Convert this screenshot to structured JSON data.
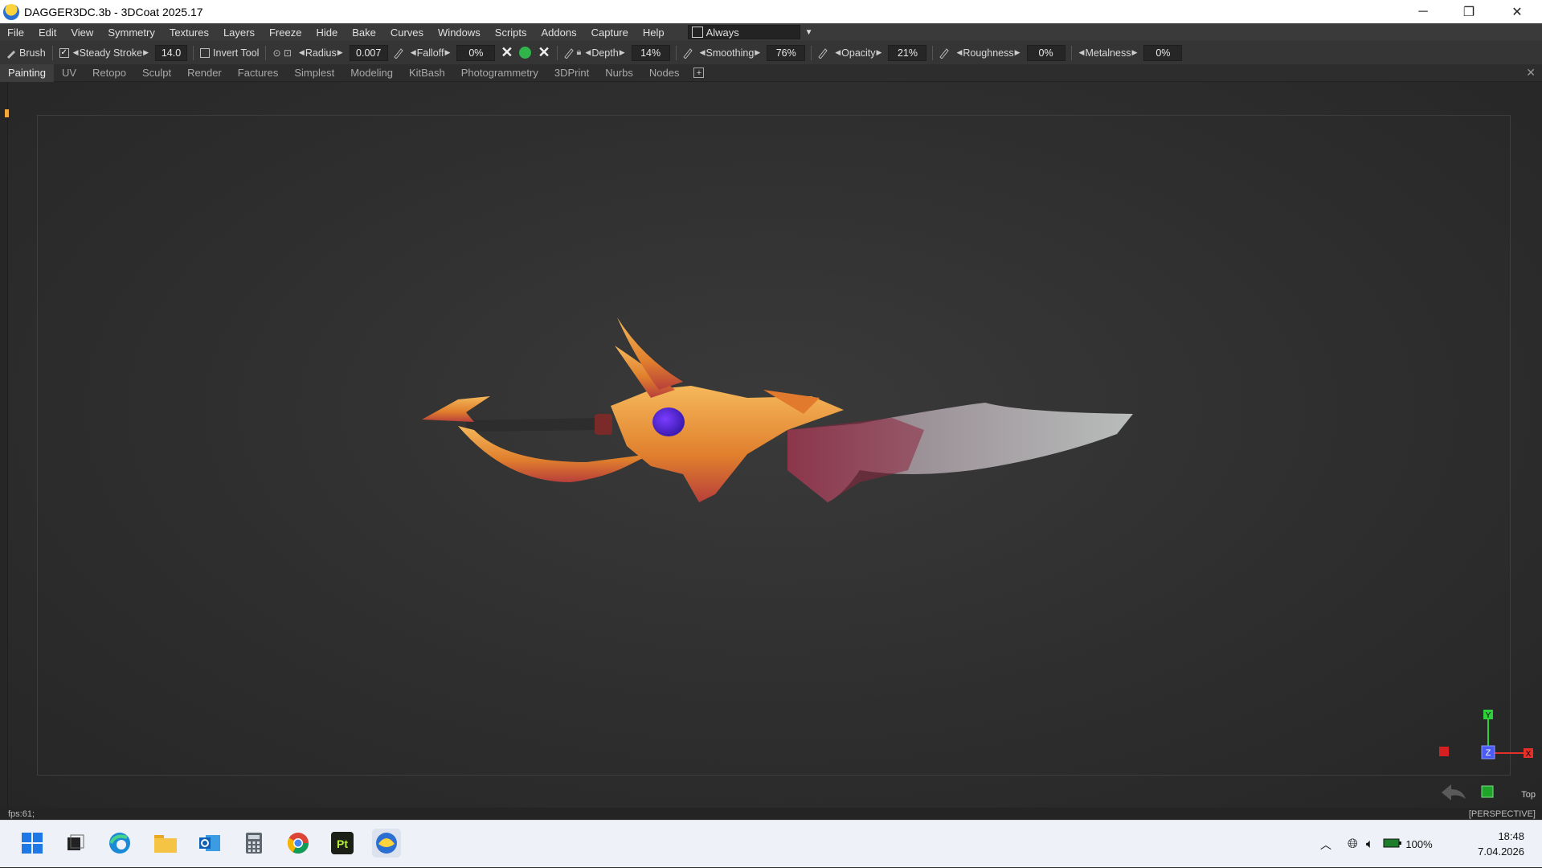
{
  "window": {
    "title": "DAGGER3DC.3b - 3DCoat 2025.17",
    "controls": {
      "minimize": "─",
      "restore": "❐",
      "close": "✕"
    }
  },
  "menu": {
    "items": [
      "File",
      "Edit",
      "View",
      "Symmetry",
      "Textures",
      "Layers",
      "Freeze",
      "Hide",
      "Bake",
      "Curves",
      "Windows",
      "Scripts",
      "Addons",
      "Capture",
      "Help"
    ],
    "always_label": "Always"
  },
  "toolbar": {
    "brush_label": "Brush",
    "steady_stroke_label": "Steady  Stroke",
    "steady_stroke_value": "14.0",
    "invert_tool_label": "Invert  Tool",
    "radius_label": "Radius",
    "radius_value": "0.007",
    "falloff_label": "Falloff",
    "falloff_value": "0%",
    "depth_label": "Depth",
    "depth_value": "14%",
    "smoothing_label": "Smoothing",
    "smoothing_value": "76%",
    "opacity_label": "Opacity",
    "opacity_value": "21%",
    "roughness_label": "Roughness",
    "roughness_value": "0%",
    "metalness_label": "Metalness",
    "metalness_value": "0%"
  },
  "rooms": {
    "tabs": [
      "Painting",
      "UV",
      "Retopo",
      "Sculpt",
      "Render",
      "Factures",
      "Simplest",
      "Modeling",
      "KitBash",
      "Photogrammetry",
      "3DPrint",
      "Nurbs",
      "Nodes"
    ],
    "active": "Painting"
  },
  "viewport": {
    "view_name": "Top",
    "projection": "[PERSPECTIVE]",
    "fps": "fps:61;",
    "gizmo": {
      "x": "X",
      "y": "Y",
      "z": "Z"
    }
  },
  "taskbar": {
    "battery": "100%",
    "time": "18:48",
    "date": "7.04.2026",
    "apps": [
      "start-menu",
      "task-view",
      "edge",
      "file-explorer",
      "outlook",
      "calculator",
      "chrome",
      "photoshop-pt",
      "3dcoat"
    ]
  },
  "colors": {
    "gizmo_x": "#e5302a",
    "gizmo_y": "#2fcf3b",
    "gizmo_z": "#4a5cf5",
    "accent_green": "#31b44a"
  }
}
